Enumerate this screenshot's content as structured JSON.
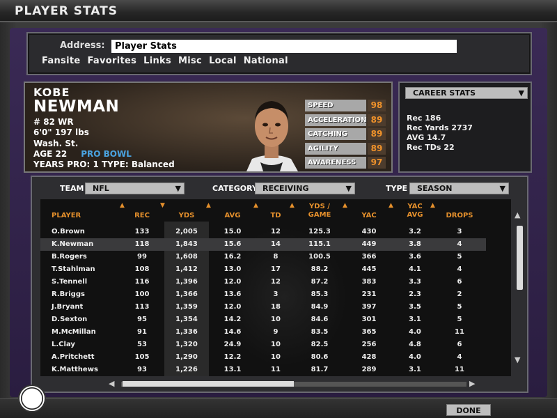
{
  "window": {
    "title": "PLAYER STATS"
  },
  "address": {
    "label": "Address:",
    "value": "Player Stats",
    "nav": [
      "Fansite",
      "Favorites",
      "Links",
      "Misc",
      "Local",
      "National"
    ]
  },
  "player": {
    "first": "KOBE",
    "last": "NEWMAN",
    "number_pos": "# 82  WR",
    "height_weight": "6'0\"   197 lbs",
    "school": "Wash. St.",
    "age": "AGE  22",
    "pro_bowl": "PRO BOWL",
    "years": "YEARS PRO:  1   TYPE: Balanced",
    "ratings": [
      {
        "label": "SPEED",
        "value": "98"
      },
      {
        "label": "ACCELERATION",
        "value": "89"
      },
      {
        "label": "CATCHING",
        "value": "89"
      },
      {
        "label": "AGILITY",
        "value": "89"
      },
      {
        "label": "AWARENESS",
        "value": "97"
      }
    ]
  },
  "career": {
    "select": "CAREER STATS",
    "lines": [
      "Rec        186",
      "Rec Yards 2737",
      "AVG        14.7",
      "Rec TDs  22"
    ]
  },
  "filters": {
    "team_label": "TEAM",
    "team_value": "NFL",
    "category_label": "CATEGORY",
    "category_value": "RECEIVING",
    "type_label": "TYPE",
    "type_value": "SEASON"
  },
  "table": {
    "headers": [
      "PLAYER",
      "REC",
      "YDS",
      "AVG",
      "TD",
      "YDS /\nGAME",
      "YAC",
      "YAC\nAVG",
      "DROPS"
    ],
    "rows": [
      [
        "O.Brown",
        "133",
        "2,005",
        "15.0",
        "12",
        "125.3",
        "430",
        "3.2",
        "3"
      ],
      [
        "K.Newman",
        "118",
        "1,843",
        "15.6",
        "14",
        "115.1",
        "449",
        "3.8",
        "4"
      ],
      [
        "B.Rogers",
        "99",
        "1,608",
        "16.2",
        "8",
        "100.5",
        "366",
        "3.6",
        "5"
      ],
      [
        "T.Stahlman",
        "108",
        "1,412",
        "13.0",
        "17",
        "88.2",
        "445",
        "4.1",
        "4"
      ],
      [
        "S.Tennell",
        "116",
        "1,396",
        "12.0",
        "12",
        "87.2",
        "383",
        "3.3",
        "6"
      ],
      [
        "R.Briggs",
        "100",
        "1,366",
        "13.6",
        "3",
        "85.3",
        "231",
        "2.3",
        "2"
      ],
      [
        "J.Bryant",
        "113",
        "1,359",
        "12.0",
        "18",
        "84.9",
        "397",
        "3.5",
        "5"
      ],
      [
        "D.Sexton",
        "95",
        "1,354",
        "14.2",
        "10",
        "84.6",
        "301",
        "3.1",
        "5"
      ],
      [
        "M.McMillan",
        "91",
        "1,336",
        "14.6",
        "9",
        "83.5",
        "365",
        "4.0",
        "11"
      ],
      [
        "L.Clay",
        "53",
        "1,320",
        "24.9",
        "10",
        "82.5",
        "256",
        "4.8",
        "6"
      ],
      [
        "A.Pritchett",
        "105",
        "1,290",
        "12.2",
        "10",
        "80.6",
        "428",
        "4.0",
        "4"
      ],
      [
        "K.Matthews",
        "93",
        "1,226",
        "13.1",
        "11",
        "81.7",
        "289",
        "3.1",
        "11"
      ]
    ],
    "selected_index": 1
  },
  "done_label": "DONE",
  "colors": {
    "accent": "#e5902c",
    "pro_bowl": "#4aa3e0",
    "panel_purple": "#3a2a55"
  }
}
